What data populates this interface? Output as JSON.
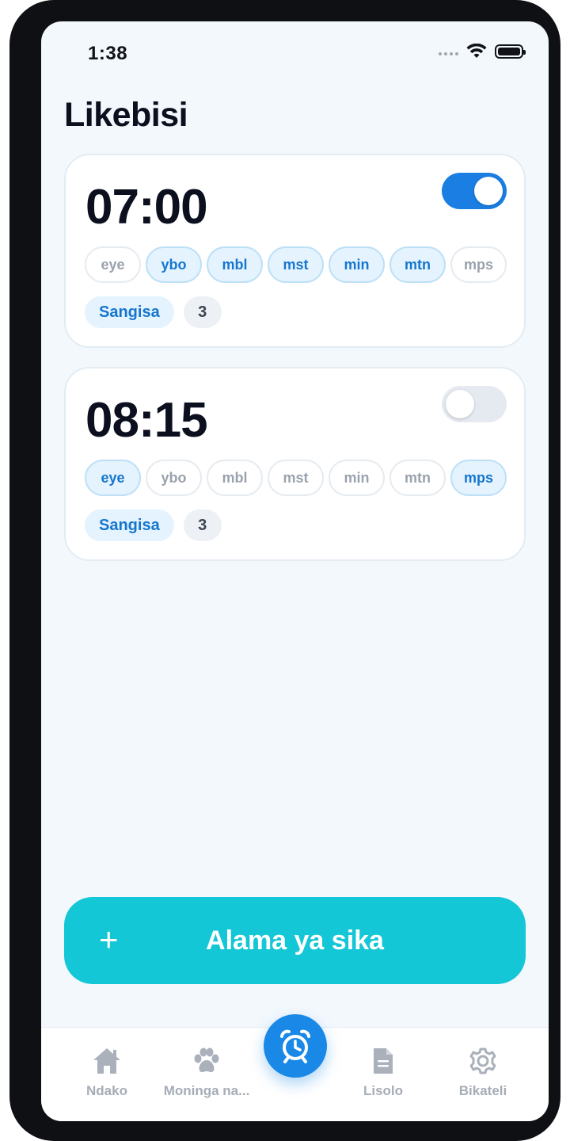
{
  "status_bar": {
    "time": "1:38"
  },
  "page": {
    "title": "Likebisi"
  },
  "alarms": [
    {
      "time": "07:00",
      "enabled": true,
      "days": [
        {
          "label": "eye",
          "active": false
        },
        {
          "label": "ybo",
          "active": true
        },
        {
          "label": "mbl",
          "active": true
        },
        {
          "label": "mst",
          "active": true
        },
        {
          "label": "min",
          "active": true
        },
        {
          "label": "mtn",
          "active": true
        },
        {
          "label": "mps",
          "active": false
        }
      ],
      "snooze_label": "Sangisa",
      "snooze_count": "3"
    },
    {
      "time": "08:15",
      "enabled": false,
      "days": [
        {
          "label": "eye",
          "active": true
        },
        {
          "label": "ybo",
          "active": false
        },
        {
          "label": "mbl",
          "active": false
        },
        {
          "label": "mst",
          "active": false
        },
        {
          "label": "min",
          "active": false
        },
        {
          "label": "mtn",
          "active": false
        },
        {
          "label": "mps",
          "active": true
        }
      ],
      "snooze_label": "Sangisa",
      "snooze_count": "3"
    }
  ],
  "add_button": {
    "label": "Alama ya sika",
    "icon": "plus-icon"
  },
  "tabbar": {
    "items": [
      {
        "label": "Ndako",
        "icon": "home-icon"
      },
      {
        "label": "Moninga na...",
        "icon": "paw-icon"
      },
      {
        "label": "",
        "icon": "alarm-clock-icon",
        "active": true
      },
      {
        "label": "Lisolo",
        "icon": "document-icon"
      },
      {
        "label": "Bikateli",
        "icon": "gear-icon"
      }
    ]
  },
  "colors": {
    "accent": "#1a7ee3",
    "add_button": "#14c7d6",
    "day_active_text": "#1676cf",
    "inactive": "#a6adb7"
  }
}
